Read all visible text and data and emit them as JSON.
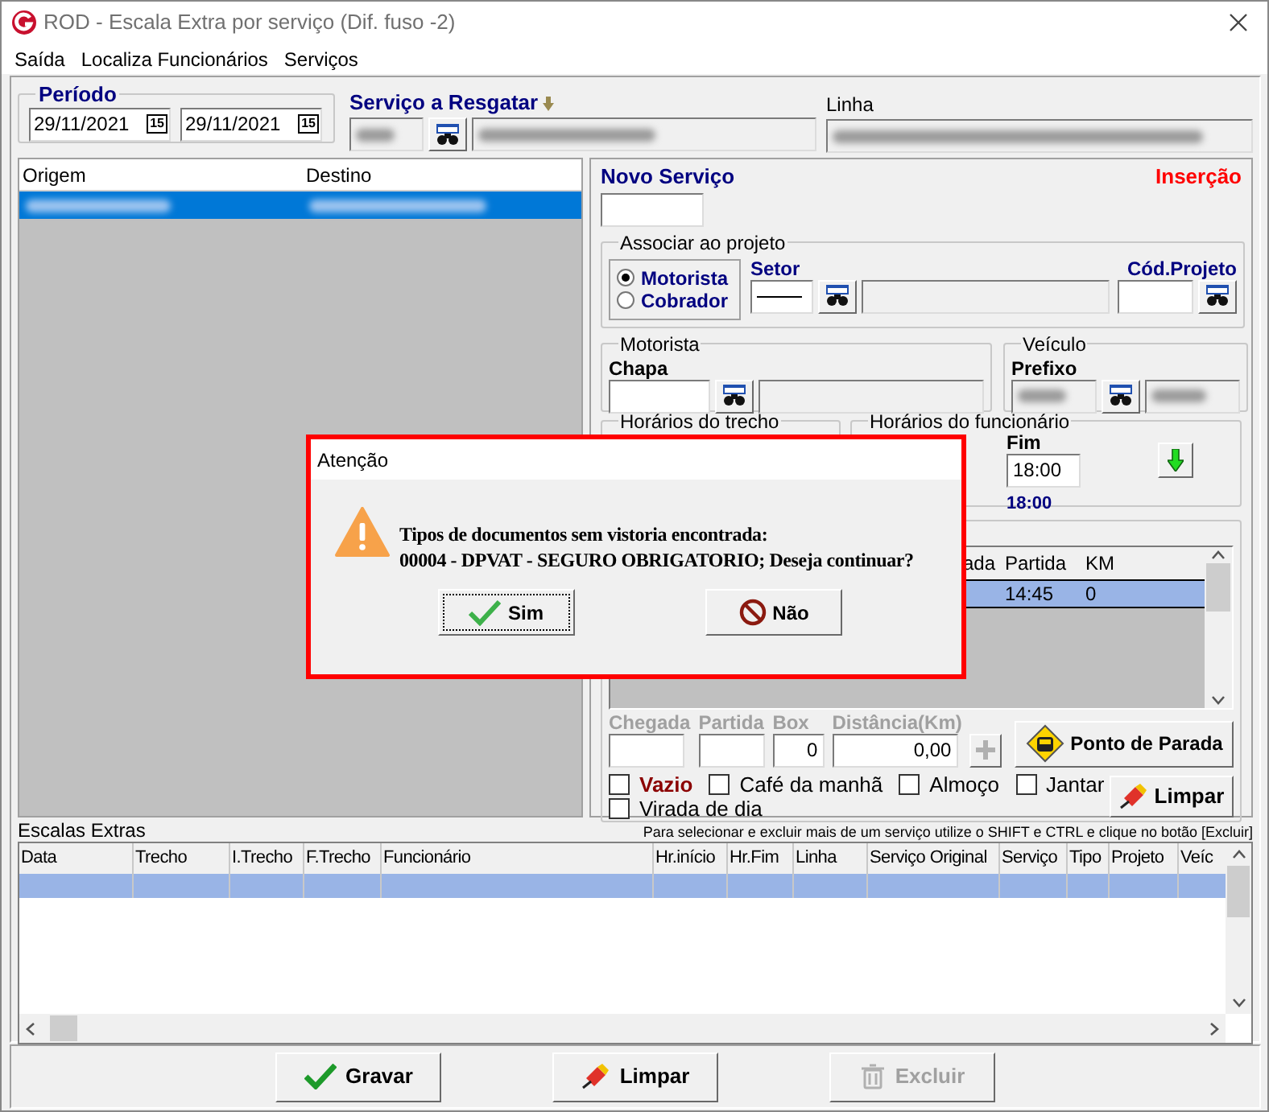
{
  "window": {
    "title": "ROD - Escala Extra por serviço (Dif. fuso -2)"
  },
  "menu": [
    "Saída",
    "Localiza Funcionários",
    "Serviços"
  ],
  "periodo": {
    "title": "Período",
    "dates": [
      {
        "value": "29/11/2021",
        "calendar_badge": "15"
      },
      {
        "value": "29/11/2021",
        "calendar_badge": "15"
      }
    ]
  },
  "servico_resgatar": {
    "label": "Serviço a Resgatar"
  },
  "linha": {
    "label": "Linha"
  },
  "route_list": {
    "columns": [
      "Origem",
      "Destino"
    ],
    "rows": [
      {
        "selected": true
      }
    ]
  },
  "novo_servico": {
    "label": "Novo Serviço",
    "mode": "Inserção"
  },
  "projeto": {
    "title": "Associar ao projeto",
    "options": [
      {
        "label": "Motorista",
        "selected": true
      },
      {
        "label": "Cobrador",
        "selected": false
      }
    ],
    "setor_label": "Setor",
    "cod_label": "Cód.Projeto"
  },
  "motorista": {
    "title": "Motorista",
    "label": "Chapa"
  },
  "veiculo": {
    "title": "Veículo",
    "label": "Prefixo"
  },
  "horarios_trecho": {
    "title": "Horários do trecho"
  },
  "horarios_funcionario": {
    "title": "Horários do funcionário",
    "fim_label": "Fim",
    "fim_value": "18:00",
    "total": "18:00"
  },
  "stops": {
    "columns": [
      "ada",
      "Partida",
      "KM"
    ],
    "rows": [
      {
        "selected": true,
        "cells": [
          "",
          "14:45",
          "0"
        ]
      }
    ]
  },
  "stop_fields": [
    {
      "label": "Chegada"
    },
    {
      "label": "Partida"
    },
    {
      "label": "Box",
      "value": "0"
    },
    {
      "label": "Distância(Km)",
      "value": "0,00"
    }
  ],
  "ponto_button": "Ponto de Parada",
  "meals": [
    {
      "label": "Vazio",
      "checked": false,
      "kind": "emphasis"
    },
    {
      "label": "Café da manhã",
      "checked": false,
      "kind": "plain"
    },
    {
      "label": "Almoço",
      "checked": false,
      "kind": "plain"
    },
    {
      "label": "Jantar",
      "checked": false,
      "kind": "plain"
    },
    {
      "label": "Virada de dia",
      "checked": false,
      "kind": "plain"
    }
  ],
  "clear_button": "Limpar",
  "extras": {
    "title": "Escalas Extras",
    "hint": "Para selecionar e excluir mais de um serviço utilize o SHIFT e CTRL e clique no botão [Excluir]",
    "columns": [
      "Data",
      "Trecho",
      "I.Trecho",
      "F.Trecho",
      "Funcionário",
      "Hr.início",
      "Hr.Fim",
      "Linha",
      "Serviço Original",
      "Serviço",
      "Tipo",
      "Projeto",
      "Veíc"
    ],
    "rows": [
      {
        "selected": true
      }
    ]
  },
  "actions": [
    {
      "label": "Gravar",
      "disabled": false
    },
    {
      "label": "Limpar",
      "disabled": false
    },
    {
      "label": "Excluir",
      "disabled": true
    }
  ],
  "dialog": {
    "title": "Atenção",
    "lines": [
      "Tipos de documentos sem vistoria encontrada:",
      "00004 - DPVAT - SEGURO OBRIGATORIO; Deseja continuar?"
    ],
    "buttons": [
      {
        "label": "Sim",
        "focused": true
      },
      {
        "label": "Não",
        "focused": false
      }
    ]
  }
}
